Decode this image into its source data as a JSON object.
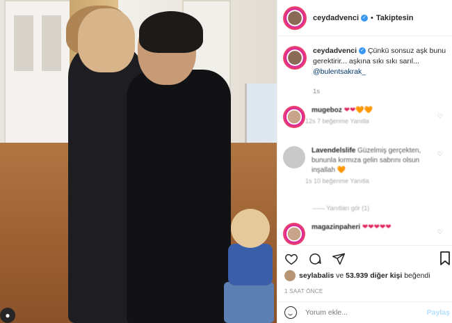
{
  "header": {
    "username": "ceydadvenci",
    "follow_status": "Takiptesin"
  },
  "caption": {
    "username": "ceydadvenci",
    "text": "Çünkü sonsuz aşk bunu gerektirir... aşkına sıkı sıkı sarıl...",
    "mention": "@bulentsakrak_",
    "ago": "1s"
  },
  "comments": [
    {
      "user": "mugeboz",
      "text": "❤❤🧡🧡",
      "meta": "12s   7 beğenme   Yanıtla"
    },
    {
      "user": "Lavendelslife",
      "text": "Güzelmiş gerçekten, bununla kırmıza gelin sabrını olsun inşallah 🧡",
      "meta": "1s   10 beğenme   Yanıtla"
    },
    {
      "user": "magazinpaheri",
      "text": "❤❤❤❤❤",
      "meta": ""
    }
  ],
  "replies_label": "Yanıtları gör (1)",
  "likes": {
    "first_user": "seylabalis",
    "and": "ve",
    "count": "53.939",
    "others": "diğer kişi",
    "suffix": "beğendi"
  },
  "time_ago": "1 SAAT ÖNCE",
  "comment_input": {
    "placeholder": "Yorum ekle...",
    "submit": "Paylaş"
  },
  "icons": {
    "like": "heart-icon",
    "comment": "comment-icon",
    "share": "paper-plane-icon",
    "save": "bookmark-icon",
    "emoji": "smiley-icon",
    "verified": "verified-badge-icon"
  },
  "colors": {
    "verified": "#3897f0",
    "link": "#00376b",
    "muted": "#8e8e8e",
    "submit": "#b2dffc"
  }
}
